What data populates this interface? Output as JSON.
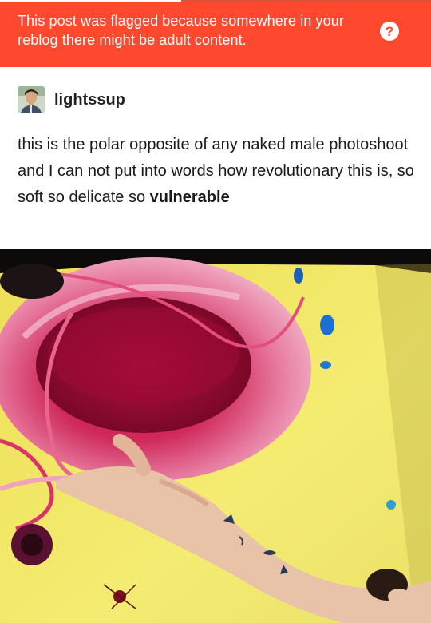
{
  "banner": {
    "message": "This post was flagged because somewhere in your reblog there might be adult content.",
    "help_icon": "?",
    "color": "#ff492f"
  },
  "reblog": {
    "username": "lightssup",
    "avatar_icon": "avatar-photo"
  },
  "post": {
    "text": "this is the polar opposite of any naked male photoshoot and I can not put into words how revolutionary this is, so soft so delicate so",
    "emphasis": "vulnerable"
  },
  "image": {
    "icon": "photo-image"
  }
}
